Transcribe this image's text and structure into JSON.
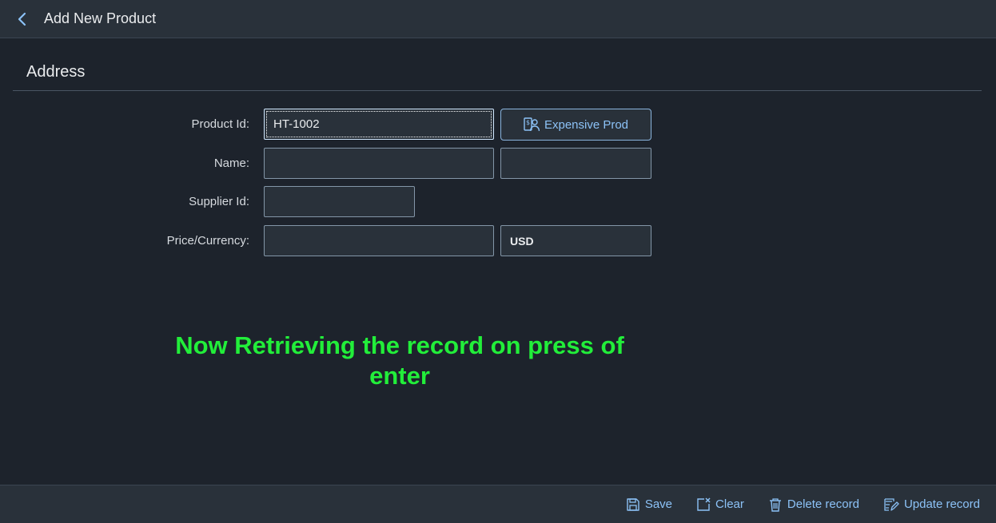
{
  "header": {
    "title": "Add New Product",
    "back_icon": "chevron-left-icon"
  },
  "section": {
    "title": "Address"
  },
  "form": {
    "product_id": {
      "label": "Product Id:",
      "value": "HT-1002"
    },
    "expensive_button": {
      "label": "Expensive Prod",
      "icon": "person-money-icon"
    },
    "name": {
      "label": "Name:",
      "value": "",
      "secondary_value": ""
    },
    "supplier_id": {
      "label": "Supplier Id:",
      "value": ""
    },
    "price_currency": {
      "label": "Price/Currency:",
      "price": "",
      "currency": "USD"
    }
  },
  "overlay": {
    "line1": "Now Retrieving the record on press of",
    "line2": "enter"
  },
  "footer": {
    "save_label": "Save",
    "clear_label": "Clear",
    "delete_label": "Delete record",
    "update_label": "Update record"
  },
  "colors": {
    "background": "#1d232c",
    "bar": "#29313a",
    "accent": "#8cc2f7",
    "overlay_text": "#22ee3a"
  }
}
